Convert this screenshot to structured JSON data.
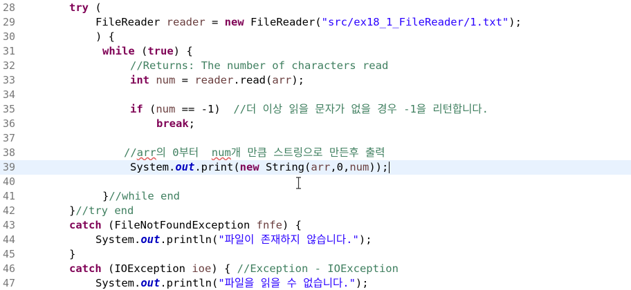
{
  "editor": {
    "lines": [
      {
        "num": "28",
        "tokens": [
          {
            "t": "try",
            "c": "kw"
          },
          {
            "t": " (",
            "c": "plain"
          }
        ]
      },
      {
        "num": "29",
        "tokens": [
          {
            "t": "FileReader ",
            "c": "plain"
          },
          {
            "t": "reader",
            "c": "var"
          },
          {
            "t": " = ",
            "c": "plain"
          },
          {
            "t": "new",
            "c": "kw"
          },
          {
            "t": " FileReader(",
            "c": "plain"
          },
          {
            "t": "\"src/ex18_1_FileReader/1.txt\"",
            "c": "str"
          },
          {
            "t": ");",
            "c": "plain"
          }
        ]
      },
      {
        "num": "30",
        "tokens": [
          {
            "t": ") {",
            "c": "plain"
          }
        ]
      },
      {
        "num": "31",
        "tokens": [
          {
            "t": "while",
            "c": "kw"
          },
          {
            "t": " (",
            "c": "plain"
          },
          {
            "t": "true",
            "c": "kw"
          },
          {
            "t": ") {",
            "c": "plain"
          }
        ]
      },
      {
        "num": "32",
        "tokens": [
          {
            "t": "//Returns: The number of characters read",
            "c": "cmt"
          }
        ]
      },
      {
        "num": "33",
        "tokens": [
          {
            "t": "int",
            "c": "kw"
          },
          {
            "t": " ",
            "c": "plain"
          },
          {
            "t": "num",
            "c": "var"
          },
          {
            "t": " = ",
            "c": "plain"
          },
          {
            "t": "reader",
            "c": "var"
          },
          {
            "t": ".read(",
            "c": "plain"
          },
          {
            "t": "arr",
            "c": "var"
          },
          {
            "t": ");",
            "c": "plain"
          }
        ]
      },
      {
        "num": "34",
        "tokens": []
      },
      {
        "num": "35",
        "tokens": [
          {
            "t": "if",
            "c": "kw"
          },
          {
            "t": " (",
            "c": "plain"
          },
          {
            "t": "num",
            "c": "var"
          },
          {
            "t": " == -1)  ",
            "c": "plain"
          },
          {
            "t": "//더 이상 읽을 문자가 없을 경우 -1을 리턴합니다.",
            "c": "cmt"
          }
        ]
      },
      {
        "num": "36",
        "tokens": [
          {
            "t": "break",
            "c": "kw"
          },
          {
            "t": ";",
            "c": "plain"
          }
        ]
      },
      {
        "num": "37",
        "tokens": []
      },
      {
        "num": "38",
        "tokens": [
          {
            "t": "//",
            "c": "cmt"
          },
          {
            "t": "arr",
            "c": "cmt spell"
          },
          {
            "t": "의 0부터  ",
            "c": "cmt"
          },
          {
            "t": "num",
            "c": "cmt spell"
          },
          {
            "t": "개 만큼 스트링으로 만든후 출력",
            "c": "cmt"
          }
        ]
      },
      {
        "num": "39",
        "tokens": [
          {
            "t": "System.",
            "c": "plain"
          },
          {
            "t": "out",
            "c": "fld"
          },
          {
            "t": ".print(",
            "c": "plain"
          },
          {
            "t": "new",
            "c": "kw"
          },
          {
            "t": " String(",
            "c": "plain"
          },
          {
            "t": "arr",
            "c": "var"
          },
          {
            "t": ",0,",
            "c": "plain"
          },
          {
            "t": "num",
            "c": "var"
          },
          {
            "t": "));",
            "c": "plain"
          }
        ]
      },
      {
        "num": "40",
        "tokens": []
      },
      {
        "num": "41",
        "tokens": [
          {
            "t": "}",
            "c": "plain"
          },
          {
            "t": "//while end",
            "c": "cmt"
          }
        ]
      },
      {
        "num": "42",
        "tokens": [
          {
            "t": "}",
            "c": "plain"
          },
          {
            "t": "//try end",
            "c": "cmt"
          }
        ]
      },
      {
        "num": "43",
        "tokens": [
          {
            "t": "catch",
            "c": "kw"
          },
          {
            "t": " (FileNotFoundException ",
            "c": "plain"
          },
          {
            "t": "fnfe",
            "c": "var"
          },
          {
            "t": ") {",
            "c": "plain"
          }
        ]
      },
      {
        "num": "44",
        "tokens": [
          {
            "t": "System.",
            "c": "plain"
          },
          {
            "t": "out",
            "c": "fld"
          },
          {
            "t": ".println(",
            "c": "plain"
          },
          {
            "t": "\"파일이 존재하지 않습니다.\"",
            "c": "str"
          },
          {
            "t": ");",
            "c": "plain"
          }
        ]
      },
      {
        "num": "45",
        "tokens": [
          {
            "t": "}",
            "c": "plain"
          }
        ]
      },
      {
        "num": "46",
        "tokens": [
          {
            "t": "catch",
            "c": "kw"
          },
          {
            "t": " (IOException ",
            "c": "plain"
          },
          {
            "t": "ioe",
            "c": "var"
          },
          {
            "t": ") { ",
            "c": "plain"
          },
          {
            "t": "//Exception - IOException",
            "c": "cmt"
          }
        ]
      },
      {
        "num": "47",
        "tokens": [
          {
            "t": "System.",
            "c": "plain"
          },
          {
            "t": "out",
            "c": "fld"
          },
          {
            "t": ".println(",
            "c": "plain"
          },
          {
            "t": "\"파일을 읽을 수 없습니다.\"",
            "c": "str"
          },
          {
            "t": ");",
            "c": "plain"
          }
        ]
      }
    ],
    "current_line": "39",
    "colors": {
      "keyword": "#7f0055",
      "string": "#2a00ff",
      "comment": "#3f7f5f",
      "local_variable": "#6a3e3e",
      "static_field": "#0000c0",
      "current_line_highlight": "#e8f2fe",
      "line_number": "#787878"
    },
    "mouse_cursor_icon": "text-ibeam-icon"
  }
}
